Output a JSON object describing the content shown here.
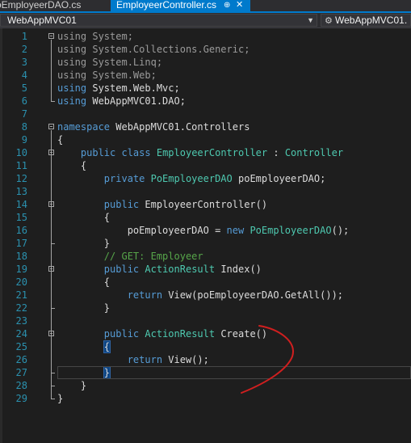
{
  "tabs": [
    {
      "label": "oEmployeerDAO.cs"
    },
    {
      "label": "EmployeerController.cs",
      "pin": "⊕",
      "close": "✕"
    }
  ],
  "nav": {
    "project": "WebAppMVC01",
    "project_right": "WebAppMVC01."
  },
  "code_lines": [
    {
      "n": "1",
      "tokens": [
        {
          "c": "gray",
          "t": "using System;"
        }
      ]
    },
    {
      "n": "2",
      "tokens": [
        {
          "c": "gray",
          "t": "using System.Collections.Generic;"
        }
      ]
    },
    {
      "n": "3",
      "tokens": [
        {
          "c": "gray",
          "t": "using System.Linq;"
        }
      ]
    },
    {
      "n": "4",
      "tokens": [
        {
          "c": "gray",
          "t": "using System.Web;"
        }
      ]
    },
    {
      "n": "5",
      "tokens": [
        {
          "c": "kw",
          "t": "using"
        },
        {
          "c": "",
          "t": " System.Web.Mvc;"
        }
      ]
    },
    {
      "n": "6",
      "tokens": [
        {
          "c": "kw",
          "t": "using"
        },
        {
          "c": "",
          "t": " WebAppMVC01.DAO;"
        }
      ]
    },
    {
      "n": "7",
      "tokens": []
    },
    {
      "n": "8",
      "tokens": [
        {
          "c": "kw",
          "t": "namespace"
        },
        {
          "c": "",
          "t": " WebAppMVC01.Controllers"
        }
      ]
    },
    {
      "n": "9",
      "tokens": [
        {
          "c": "",
          "t": "{"
        }
      ]
    },
    {
      "n": "10",
      "tokens": [
        {
          "c": "",
          "t": "    "
        },
        {
          "c": "kw",
          "t": "public class"
        },
        {
          "c": "",
          "t": " "
        },
        {
          "c": "ty",
          "t": "EmployeerController"
        },
        {
          "c": "",
          "t": " : "
        },
        {
          "c": "ty",
          "t": "Controller"
        }
      ]
    },
    {
      "n": "11",
      "tokens": [
        {
          "c": "",
          "t": "    {"
        }
      ]
    },
    {
      "n": "12",
      "tokens": [
        {
          "c": "",
          "t": "        "
        },
        {
          "c": "kw",
          "t": "private"
        },
        {
          "c": "",
          "t": " "
        },
        {
          "c": "ty",
          "t": "PoEmployeerDAO"
        },
        {
          "c": "",
          "t": " poEmployeerDAO;"
        }
      ]
    },
    {
      "n": "13",
      "tokens": []
    },
    {
      "n": "14",
      "tokens": [
        {
          "c": "",
          "t": "        "
        },
        {
          "c": "kw",
          "t": "public"
        },
        {
          "c": "",
          "t": " EmployeerController()"
        }
      ]
    },
    {
      "n": "15",
      "tokens": [
        {
          "c": "",
          "t": "        {"
        }
      ]
    },
    {
      "n": "16",
      "tokens": [
        {
          "c": "",
          "t": "            poEmployeerDAO = "
        },
        {
          "c": "kw",
          "t": "new"
        },
        {
          "c": "",
          "t": " "
        },
        {
          "c": "ty",
          "t": "PoEmployeerDAO"
        },
        {
          "c": "",
          "t": "();"
        }
      ]
    },
    {
      "n": "17",
      "tokens": [
        {
          "c": "",
          "t": "        }"
        }
      ]
    },
    {
      "n": "18",
      "tokens": [
        {
          "c": "",
          "t": "        "
        },
        {
          "c": "cm",
          "t": "// GET: Employeer"
        }
      ]
    },
    {
      "n": "19",
      "tokens": [
        {
          "c": "",
          "t": "        "
        },
        {
          "c": "kw",
          "t": "public"
        },
        {
          "c": "",
          "t": " "
        },
        {
          "c": "ty",
          "t": "ActionResult"
        },
        {
          "c": "",
          "t": " Index()"
        }
      ]
    },
    {
      "n": "20",
      "tokens": [
        {
          "c": "",
          "t": "        {"
        }
      ]
    },
    {
      "n": "21",
      "tokens": [
        {
          "c": "",
          "t": "            "
        },
        {
          "c": "kw",
          "t": "return"
        },
        {
          "c": "",
          "t": " View(poEmployeerDAO.GetAll());"
        }
      ]
    },
    {
      "n": "22",
      "tokens": [
        {
          "c": "",
          "t": "        }"
        }
      ]
    },
    {
      "n": "23",
      "tokens": []
    },
    {
      "n": "24",
      "tokens": [
        {
          "c": "",
          "t": "        "
        },
        {
          "c": "kw",
          "t": "public"
        },
        {
          "c": "",
          "t": " "
        },
        {
          "c": "ty",
          "t": "ActionResult"
        },
        {
          "c": "",
          "t": " Create()"
        }
      ]
    },
    {
      "n": "25",
      "tokens": [
        {
          "c": "",
          "t": "        "
        },
        {
          "c": "brk",
          "t": "{"
        }
      ]
    },
    {
      "n": "26",
      "tokens": [
        {
          "c": "",
          "t": "            "
        },
        {
          "c": "kw",
          "t": "return"
        },
        {
          "c": "",
          "t": " View();"
        }
      ]
    },
    {
      "n": "27",
      "tokens": [
        {
          "c": "",
          "t": "        "
        },
        {
          "c": "brk",
          "t": "}"
        }
      ]
    },
    {
      "n": "28",
      "tokens": [
        {
          "c": "",
          "t": "    }"
        }
      ]
    },
    {
      "n": "29",
      "tokens": [
        {
          "c": "",
          "t": "}"
        }
      ]
    }
  ],
  "colors": {
    "background": "#1e1e1e",
    "keyword": "#569cd6",
    "type": "#4ec9b0",
    "comment": "#57a64a",
    "line_number": "#2b91af",
    "annotation_stroke": "#d01f1f",
    "tab_active": "#007acc"
  }
}
